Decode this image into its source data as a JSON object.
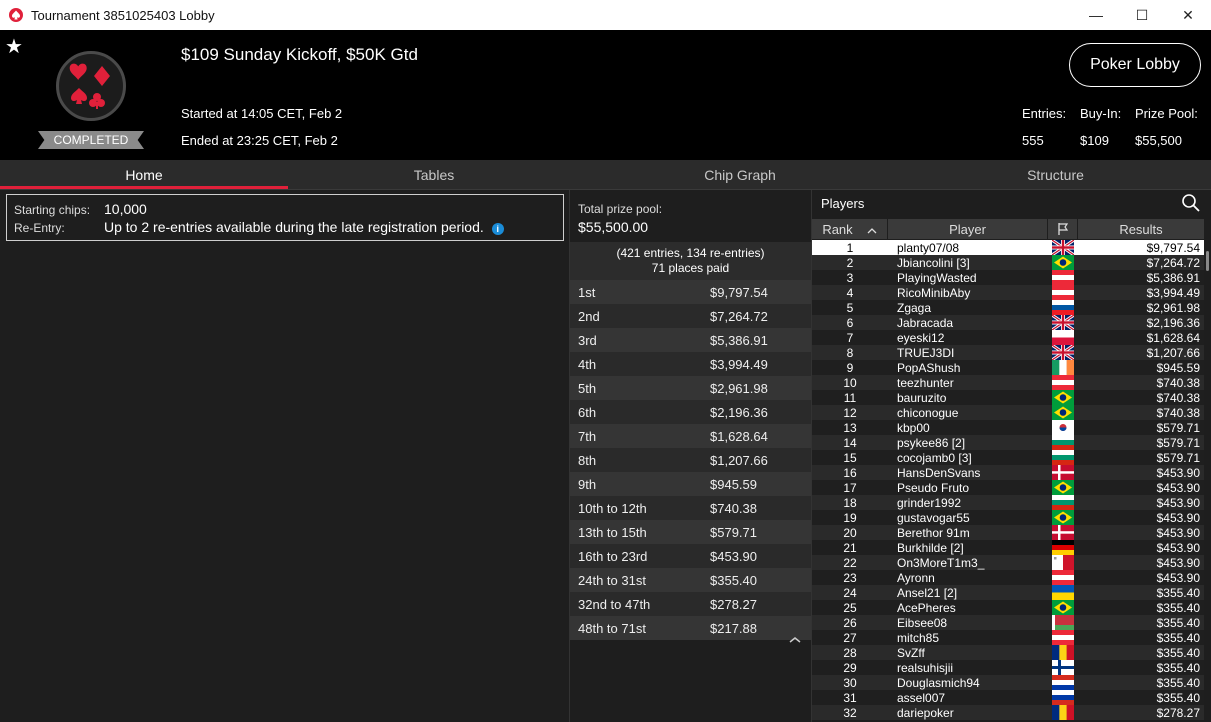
{
  "window": {
    "title": "Tournament 3851025403 Lobby",
    "controls": [
      "—",
      "☐",
      "✕"
    ]
  },
  "header": {
    "tournament_name": "$109 Sunday Kickoff, $50K Gtd",
    "status_badge": "COMPLETED",
    "started": "Started at 14:05 CET, Feb 2",
    "ended": "Ended at 23:25 CET, Feb 2",
    "poker_lobby_button": "Poker Lobby",
    "entries_label": "Entries:",
    "entries_value": "555",
    "buyin_label": "Buy-In:",
    "buyin_value": "$109",
    "prize_pool_label": "Prize Pool:",
    "prize_pool_value": "$55,500"
  },
  "tabs": [
    "Home",
    "Tables",
    "Chip Graph",
    "Structure"
  ],
  "home": {
    "starting_chips_label": "Starting chips:",
    "starting_chips_value": "10,000",
    "reentry_label": "Re-Entry:",
    "reentry_value": "Up to 2 re-entries available during the late registration period."
  },
  "prizes": {
    "total_label": "Total prize pool:",
    "total_value": "$55,500.00",
    "entries_summary": "(421 entries, 134 re-entries)",
    "places_paid": "71 places paid",
    "rows": [
      {
        "place": "1st",
        "amount": "$9,797.54"
      },
      {
        "place": "2nd",
        "amount": "$7,264.72"
      },
      {
        "place": "3rd",
        "amount": "$5,386.91"
      },
      {
        "place": "4th",
        "amount": "$3,994.49"
      },
      {
        "place": "5th",
        "amount": "$2,961.98"
      },
      {
        "place": "6th",
        "amount": "$2,196.36"
      },
      {
        "place": "7th",
        "amount": "$1,628.64"
      },
      {
        "place": "8th",
        "amount": "$1,207.66"
      },
      {
        "place": "9th",
        "amount": "$945.59"
      },
      {
        "place": "10th to 12th",
        "amount": "$740.38"
      },
      {
        "place": "13th to 15th",
        "amount": "$579.71"
      },
      {
        "place": "16th to 23rd",
        "amount": "$453.90"
      },
      {
        "place": "24th to 31st",
        "amount": "$355.40"
      },
      {
        "place": "32nd to 47th",
        "amount": "$278.27"
      },
      {
        "place": "48th to 71st",
        "amount": "$217.88"
      }
    ]
  },
  "players": {
    "title": "Players",
    "columns": {
      "rank": "Rank",
      "player": "Player",
      "results": "Results"
    },
    "rows": [
      {
        "rank": "1",
        "name": "planty07/08",
        "flag": "gb",
        "result": "$9,797.54"
      },
      {
        "rank": "2",
        "name": "Jbiancolini [3]",
        "flag": "br",
        "result": "$7,264.72"
      },
      {
        "rank": "3",
        "name": "PlayingWasted",
        "flag": "at",
        "result": "$5,386.91"
      },
      {
        "rank": "4",
        "name": "RicoMinibAby",
        "flag": "at",
        "result": "$3,994.49"
      },
      {
        "rank": "5",
        "name": "Zgaga",
        "flag": "si",
        "result": "$2,961.98"
      },
      {
        "rank": "6",
        "name": "Jabracada",
        "flag": "gb",
        "result": "$2,196.36"
      },
      {
        "rank": "7",
        "name": "eyeski12",
        "flag": "pl",
        "result": "$1,628.64"
      },
      {
        "rank": "8",
        "name": "TRUEJ3DI",
        "flag": "gb",
        "result": "$1,207.66"
      },
      {
        "rank": "9",
        "name": "PopAShush",
        "flag": "ie",
        "result": "$945.59"
      },
      {
        "rank": "10",
        "name": "teezhunter",
        "flag": "at",
        "result": "$740.38"
      },
      {
        "rank": "11",
        "name": "bauruzito",
        "flag": "br",
        "result": "$740.38"
      },
      {
        "rank": "12",
        "name": "chiconogue",
        "flag": "br",
        "result": "$740.38"
      },
      {
        "rank": "13",
        "name": "kbp00",
        "flag": "kr",
        "result": "$579.71"
      },
      {
        "rank": "14",
        "name": "psykee86 [2]",
        "flag": "bg",
        "result": "$579.71"
      },
      {
        "rank": "15",
        "name": "cocojamb0 [3]",
        "flag": "bg",
        "result": "$579.71"
      },
      {
        "rank": "16",
        "name": "HansDenSvans",
        "flag": "dk",
        "result": "$453.90"
      },
      {
        "rank": "17",
        "name": "Pseudo Fruto",
        "flag": "br",
        "result": "$453.90"
      },
      {
        "rank": "18",
        "name": "grinder1992",
        "flag": "bg",
        "result": "$453.90"
      },
      {
        "rank": "19",
        "name": "gustavogar55",
        "flag": "br",
        "result": "$453.90"
      },
      {
        "rank": "20",
        "name": "Berethor 91m",
        "flag": "dk",
        "result": "$453.90"
      },
      {
        "rank": "21",
        "name": "Burkhilde [2]",
        "flag": "de",
        "result": "$453.90"
      },
      {
        "rank": "22",
        "name": "On3MoreT1m3_",
        "flag": "mt",
        "result": "$453.90"
      },
      {
        "rank": "23",
        "name": "Ayronn",
        "flag": "at",
        "result": "$453.90"
      },
      {
        "rank": "24",
        "name": "Ansel21 [2]",
        "flag": "ua",
        "result": "$355.40"
      },
      {
        "rank": "25",
        "name": "AcePheres",
        "flag": "br",
        "result": "$355.40"
      },
      {
        "rank": "26",
        "name": "Eibsee08",
        "flag": "by",
        "result": "$355.40"
      },
      {
        "rank": "27",
        "name": "mitch85",
        "flag": "at",
        "result": "$355.40"
      },
      {
        "rank": "28",
        "name": "SvZff",
        "flag": "ro",
        "result": "$355.40"
      },
      {
        "rank": "29",
        "name": "realsuhisjii",
        "flag": "fi",
        "result": "$355.40"
      },
      {
        "rank": "30",
        "name": "Douglasmich94",
        "flag": "py",
        "result": "$355.40"
      },
      {
        "rank": "31",
        "name": "assel007",
        "flag": "ru",
        "result": "$355.40"
      },
      {
        "rank": "32",
        "name": "dariepoker",
        "flag": "ro",
        "result": "$278.27"
      }
    ]
  },
  "icons": {
    "app": "pokerstars-spade-icon",
    "favorite": "star-icon",
    "logo": "card-suits-logo",
    "search": "search-icon",
    "flag_header": "flag-icon",
    "sort": "caret-up-icon",
    "info": "info-icon",
    "collapse": "chevron-up-icon"
  },
  "colors": {
    "accent": "#e0203a",
    "background": "#1e1e1e",
    "header": "#000000"
  }
}
